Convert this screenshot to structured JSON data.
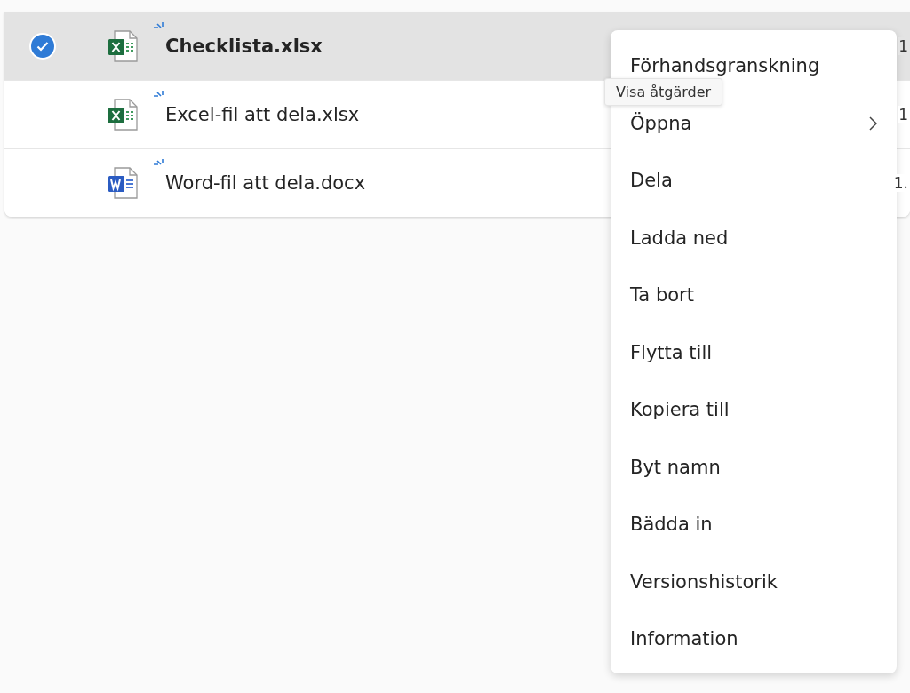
{
  "files": [
    {
      "name": "Checklista.xlsx",
      "kind": "excel",
      "selected": true,
      "column_3": "1"
    },
    {
      "name": "Excel-fil att dela.xlsx",
      "kind": "excel",
      "selected": false,
      "column_3": "1"
    },
    {
      "name": "Word-fil att dela.docx",
      "kind": "word",
      "selected": false,
      "column_3": "1."
    }
  ],
  "tooltip": "Visa åtgärder",
  "menu": [
    {
      "label": "Förhandsgranskning",
      "submenu": false
    },
    {
      "label": "Öppna",
      "submenu": true
    },
    {
      "label": "Dela",
      "submenu": false
    },
    {
      "label": "Ladda ned",
      "submenu": false
    },
    {
      "label": "Ta bort",
      "submenu": false
    },
    {
      "label": "Flytta till",
      "submenu": false
    },
    {
      "label": "Kopiera till",
      "submenu": false
    },
    {
      "label": "Byt namn",
      "submenu": false
    },
    {
      "label": "Bädda in",
      "submenu": false
    },
    {
      "label": "Versionshistorik",
      "submenu": false
    },
    {
      "label": "Information",
      "submenu": false
    }
  ]
}
